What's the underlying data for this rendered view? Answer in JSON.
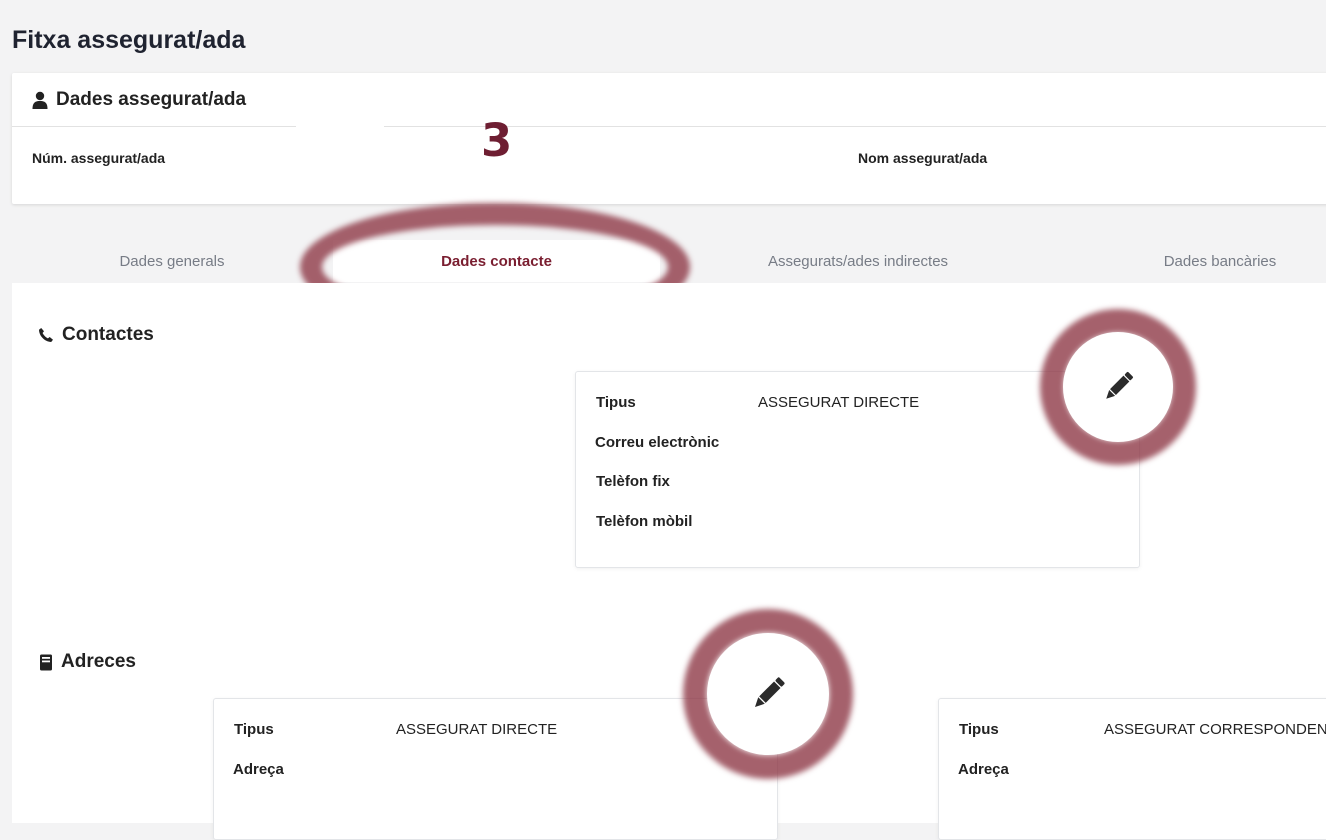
{
  "page": {
    "title": "Fitxa assegurat/ada"
  },
  "insured_card": {
    "header": "Dades assegurat/ada",
    "fields": {
      "number_label": "Núm. assegurat/ada",
      "name_label": "Nom assegurat/ada"
    }
  },
  "annotation": {
    "step": "3"
  },
  "tabs": [
    {
      "label": "Dades generals",
      "active": false
    },
    {
      "label": "Dades contacte",
      "active": true
    },
    {
      "label": "Assegurats/ades indirectes",
      "active": false
    },
    {
      "label": "Dades bancàries",
      "active": false
    }
  ],
  "contacts": {
    "title": "Contactes",
    "card": {
      "type_label": "Tipus",
      "type_value": "ASSEGURAT DIRECTE",
      "email_label": "Correu electrònic",
      "phone_label": "Telèfon fix",
      "mobile_label": "Telèfon mòbil"
    }
  },
  "addresses": {
    "title": "Adreces",
    "cards": [
      {
        "type_label": "Tipus",
        "type_value": "ASSEGURAT DIRECTE",
        "address_label": "Adreça"
      },
      {
        "type_label": "Tipus",
        "type_value": "ASSEGURAT CORRESPONDENCIA",
        "address_label": "Adreça"
      }
    ]
  },
  "colors": {
    "accent": "#7a1e30",
    "highlight_ring": "#8c3442",
    "background": "#f3f3f4"
  }
}
